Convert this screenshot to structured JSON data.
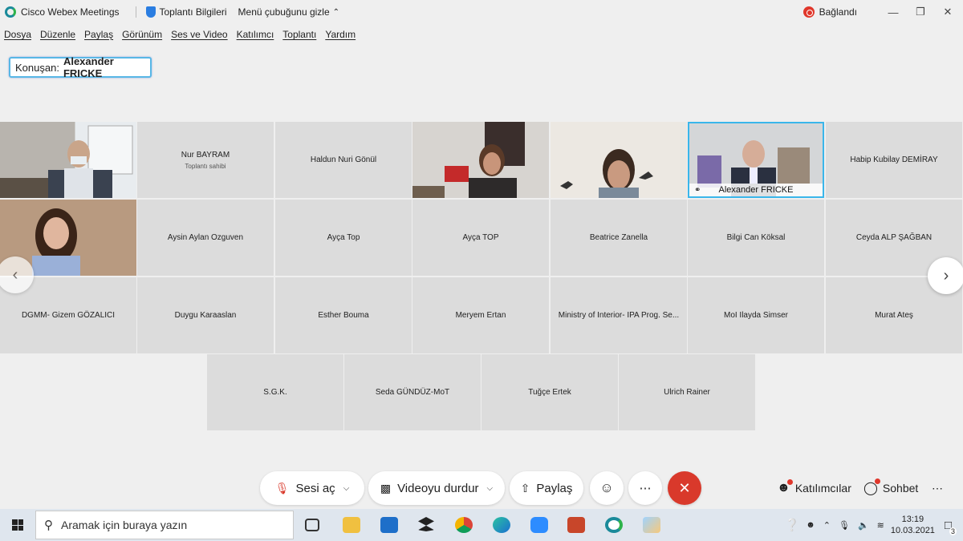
{
  "titlebar": {
    "app_name": "Cisco Webex Meetings",
    "meeting_info": "Toplantı Bilgileri",
    "hide_menu": "Menü çubuğunu gizle",
    "status": "Bağlandı"
  },
  "menu": [
    "Dosya",
    "Düzenle",
    "Paylaş",
    "Görünüm",
    "Ses ve Video",
    "Katılımcı",
    "Toplantı",
    "Yardım"
  ],
  "speaker": {
    "label": "Konuşan:",
    "name": "Alexander FRICKE"
  },
  "participants": {
    "row1": [
      {
        "name": "",
        "video": true
      },
      {
        "name": "Nur BAYRAM",
        "sub": "Toplantı sahibi"
      },
      {
        "name": "Haldun Nuri Gönül"
      },
      {
        "name": "",
        "video": true
      },
      {
        "name": "",
        "video": true
      },
      {
        "name": "Alexander FRICKE",
        "video": true,
        "active": true
      },
      {
        "name": "Habip Kubilay DEMİRAY"
      }
    ],
    "row2": [
      {
        "name": "",
        "video": true
      },
      {
        "name": "Aysin Aylan Ozguven"
      },
      {
        "name": "Ayça Top"
      },
      {
        "name": "Ayça TOP"
      },
      {
        "name": "Beatrice Zanella"
      },
      {
        "name": "Bilgi Can Köksal"
      },
      {
        "name": "Ceyda ALP ŞAĞBAN"
      }
    ],
    "row3": [
      {
        "name": "DGMM- Gizem GÖZALICI"
      },
      {
        "name": "Duygu Karaaslan"
      },
      {
        "name": "Esther Bouma"
      },
      {
        "name": "Meryem Ertan"
      },
      {
        "name": "Ministry of Interior- IPA Prog. Se..."
      },
      {
        "name": "MoI Ilayda Simser"
      },
      {
        "name": "Murat Ateş"
      }
    ],
    "row4": [
      {
        "name": "S.G.K."
      },
      {
        "name": "Seda GÜNDÜZ-MoT"
      },
      {
        "name": "Tuğçe Ertek"
      },
      {
        "name": "Ulrich Rainer"
      }
    ]
  },
  "controls": {
    "unmute": "Sesi aç",
    "stop_video": "Videoyu durdur",
    "share": "Paylaş",
    "participants": "Katılımcılar",
    "chat": "Sohbet"
  },
  "taskbar": {
    "search_placeholder": "Aramak için buraya yazın",
    "time": "13:19",
    "date": "10.03.2021",
    "notifications": "3"
  },
  "colors": {
    "accent": "#3ab6ea",
    "end_call": "#d9392b",
    "record": "#e0372b"
  }
}
